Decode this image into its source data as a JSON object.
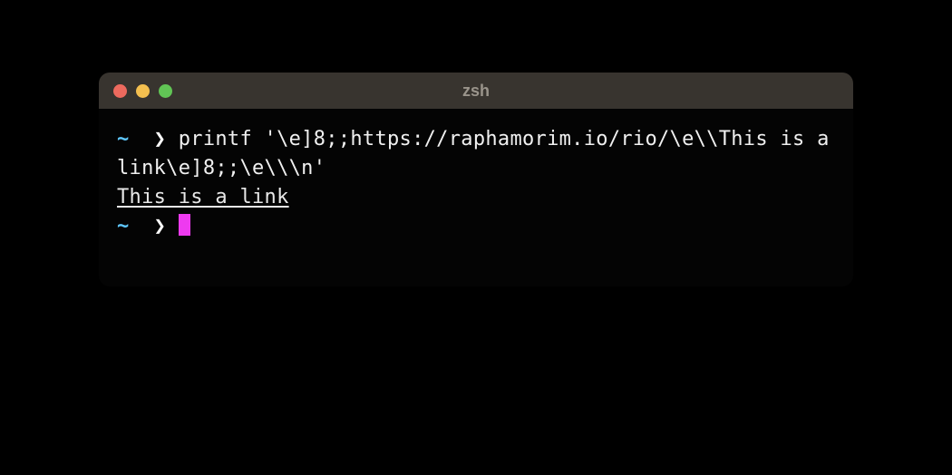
{
  "titlebar": {
    "title": "zsh"
  },
  "terminal": {
    "line1": {
      "tilde": "~",
      "arrow": "❯",
      "command": "printf '\\e]8;;https://raphamorim.io/rio/\\e\\\\This is a link\\e]8;;\\e\\\\\\n'"
    },
    "output": {
      "link_text": "This is a link"
    },
    "line2": {
      "tilde": "~",
      "arrow": "❯"
    }
  },
  "colors": {
    "cursor": "#ee3af0",
    "tilde": "#5fc8ff",
    "close": "#ed6a5e",
    "minimize": "#f4bf4f",
    "maximize": "#61c555"
  }
}
